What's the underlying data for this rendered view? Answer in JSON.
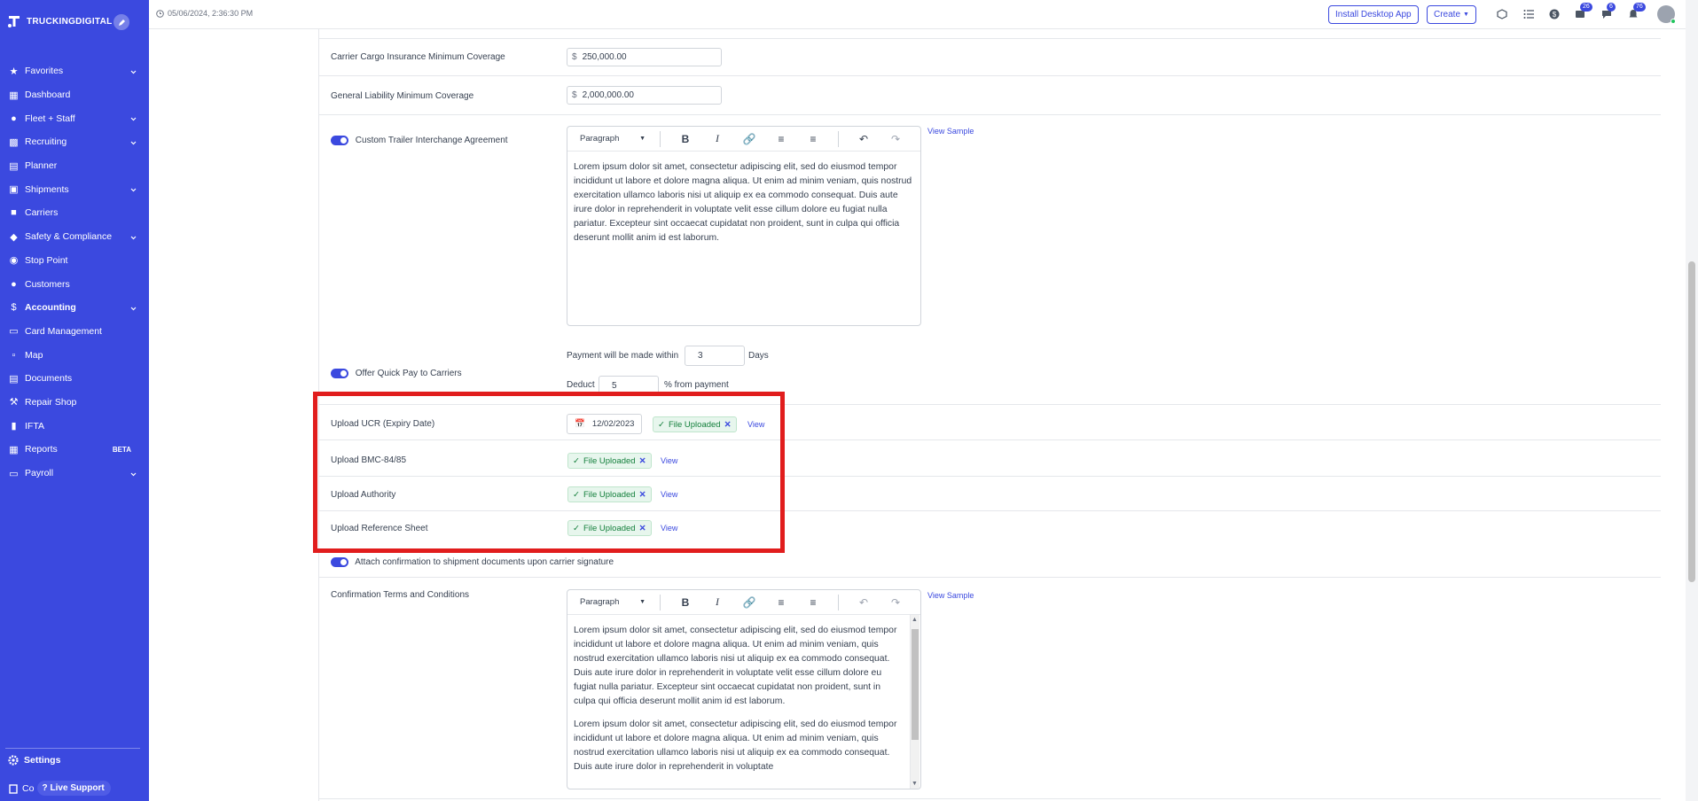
{
  "brand": {
    "name": "TRUCKINGDIGITAL"
  },
  "sidebar": {
    "items": [
      {
        "label": "Favorites",
        "icon": "star-icon",
        "chevron": true
      },
      {
        "label": "Dashboard",
        "icon": "grid-icon",
        "chevron": false
      },
      {
        "label": "Fleet + Staff",
        "icon": "people-icon",
        "chevron": true
      },
      {
        "label": "Recruiting",
        "icon": "briefcase-icon",
        "chevron": true
      },
      {
        "label": "Planner",
        "icon": "calendar-icon",
        "chevron": false
      },
      {
        "label": "Shipments",
        "icon": "truck-icon",
        "chevron": true
      },
      {
        "label": "Carriers",
        "icon": "carrier-icon",
        "chevron": false
      },
      {
        "label": "Safety & Compliance",
        "icon": "shield-icon",
        "chevron": true
      },
      {
        "label": "Stop Point",
        "icon": "pin-icon",
        "chevron": false
      },
      {
        "label": "Customers",
        "icon": "customers-icon",
        "chevron": false
      },
      {
        "label": "Accounting",
        "icon": "dollar-icon",
        "chevron": true,
        "active": true
      },
      {
        "label": "Card Management",
        "icon": "card-icon",
        "chevron": false
      },
      {
        "label": "Map",
        "icon": "map-icon",
        "chevron": false
      },
      {
        "label": "Documents",
        "icon": "document-icon",
        "chevron": false
      },
      {
        "label": "Repair Shop",
        "icon": "wrench-icon",
        "chevron": false
      },
      {
        "label": "IFTA",
        "icon": "fuel-icon",
        "chevron": false
      },
      {
        "label": "Reports",
        "icon": "report-icon",
        "chevron": false,
        "badge": "BETA"
      },
      {
        "label": "Payroll",
        "icon": "payroll-icon",
        "chevron": true
      }
    ],
    "settings_label": "Settings",
    "bottom_partial": "Co",
    "live_support": "Live Support"
  },
  "topbar": {
    "timestamp": "05/06/2024, 2:36:30 PM",
    "install_label": "Install Desktop App",
    "create_label": "Create",
    "badges": {
      "messages": "26",
      "chat": "6",
      "notifications": "76"
    }
  },
  "form": {
    "cargo_label": "Carrier Cargo Insurance Minimum Coverage",
    "cargo_currency": "$",
    "cargo_value": "250,000.00",
    "liability_label": "General Liability Minimum Coverage",
    "liability_currency": "$",
    "liability_value": "2,000,000.00",
    "interchange_label": "Custom Trailer Interchange Agreement",
    "editor_format": "Paragraph",
    "view_sample": "View Sample",
    "interchange_text": "Lorem ipsum dolor sit amet, consectetur adipiscing elit, sed do eiusmod tempor incididunt ut labore et dolore magna aliqua. Ut enim ad minim veniam, quis nostrud exercitation ullamco laboris nisi ut aliquip ex ea commodo consequat. Duis aute irure dolor in reprehenderit in voluptate velit esse cillum dolore eu fugiat nulla pariatur. Excepteur sint occaecat cupidatat non proident, sunt in culpa qui officia deserunt mollit anim id est laborum.",
    "quickpay_label": "Offer Quick Pay to Carriers",
    "payment_within": "Payment will be made within",
    "payment_days_value": "3",
    "days_label": "Days",
    "deduct_label": "Deduct",
    "deduct_value": "5",
    "deduct_suffix": "% from payment",
    "ucr_label": "Upload UCR (Expiry Date)",
    "ucr_date": "12/02/2023",
    "file_uploaded": "File Uploaded",
    "view_label": "View",
    "bmc_label": "Upload BMC-84/85",
    "authority_label": "Upload Authority",
    "reference_label": "Upload Reference Sheet",
    "attach_label": "Attach confirmation to shipment documents upon carrier signature",
    "confirmation_label": "Confirmation Terms and Conditions",
    "confirmation_p1": "Lorem ipsum dolor sit amet, consectetur adipiscing elit, sed do eiusmod tempor incididunt ut labore et dolore magna aliqua. Ut enim ad minim veniam, quis nostrud exercitation ullamco laboris nisi ut aliquip ex ea commodo consequat. Duis aute irure dolor in reprehenderit in voluptate velit esse cillum dolore eu fugiat nulla pariatur. Excepteur sint occaecat cupidatat non proident, sunt in culpa qui officia deserunt mollit anim id est laborum.",
    "confirmation_p2": "Lorem ipsum dolor sit amet, consectetur adipiscing elit, sed do eiusmod tempor incididunt ut labore et dolore magna aliqua. Ut enim ad minim veniam, quis nostrud exercitation ullamco laboris nisi ut aliquip ex ea commodo consequat. Duis aute irure dolor in reprehenderit in voluptate"
  },
  "colors": {
    "brand": "#3b49df",
    "highlight": "#e11d1d",
    "success": "#15803d"
  }
}
